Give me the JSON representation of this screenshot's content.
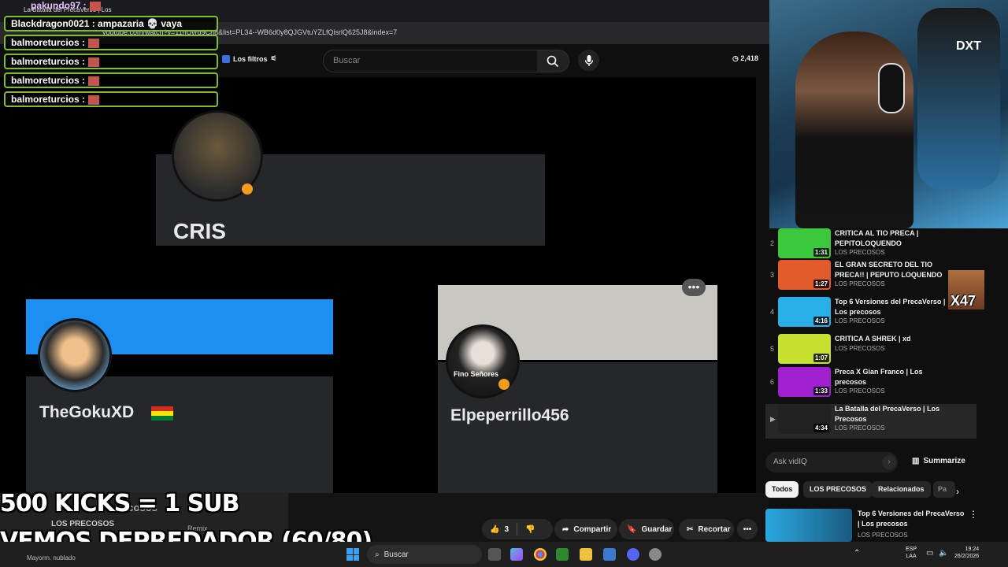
{
  "browser": {
    "address": "youtube.com/watch?v=11hUvrq9Ch8&list=PL34--WB6d0y8QJGVtuYZLfQisrlQ625J8&index=7",
    "tab_title": "La Batalla del PrecaVerso | Los"
  },
  "yt_header": {
    "filters_label": "Los filtros",
    "search_placeholder": "Buscar",
    "counter": "2,418"
  },
  "video": {
    "cards": [
      {
        "name": "CRIS"
      },
      {
        "name": "TheGokuXD"
      },
      {
        "name": "Elpeperrillo456",
        "avatar_text": "Fino Señores"
      }
    ],
    "partial_title": "recosos",
    "channel": "LOS PRECOSOS",
    "remix": "Remix"
  },
  "actions": {
    "likes": "3",
    "share": "Compartir",
    "save": "Guardar",
    "clip": "Recortar"
  },
  "chat": {
    "top_user": "pakundo97 :",
    "messages": [
      {
        "text": "Blackdragon0021 : ampazaria 💀 vaya"
      },
      {
        "text": "balmoreturcios :"
      },
      {
        "text": "balmoreturcios :"
      },
      {
        "text": "balmoreturcios :"
      },
      {
        "text": "balmoreturcios :"
      }
    ]
  },
  "promo": {
    "line1": "500 KICKS = 1 SUB",
    "line2": "VEMOS DEPREDADOR (60/80)"
  },
  "webcam": {
    "chair_logo": "DXT"
  },
  "playlist": [
    {
      "idx": "2",
      "title": "CRITICA AL TIO PRECA | PEPITOLOQUENDO",
      "channel": "LOS PRECOSOS",
      "duration": "1:31",
      "color": "#3cc83c"
    },
    {
      "idx": "3",
      "title": "EL GRAN SECRETO DEL TIO PRECA!! | PEPUTO LOQUENDO",
      "channel": "LOS PRECOSOS",
      "duration": "1:27",
      "color": "#e05a2a"
    },
    {
      "idx": "4",
      "title": "Top 6 Versiones del PrecaVerso | Los precosos",
      "channel": "LOS PRECOSOS",
      "duration": "4:16",
      "color": "#2ab0e8"
    },
    {
      "idx": "5",
      "title": "CRITICA A SHREK | xd",
      "channel": "LOS PRECOSOS",
      "duration": "1:07",
      "color": "#c8e030"
    },
    {
      "idx": "6",
      "title": "Preca X Gian Franco | Los precosos",
      "channel": "LOS PRECOSOS",
      "duration": "1:33",
      "color": "#a020d0"
    },
    {
      "idx": "▶",
      "title": "La Batalla del PrecaVerso | Los Precosos",
      "channel": "LOS PRECOSOS",
      "duration": "4:34",
      "color": "#222222"
    }
  ],
  "x47": "X47",
  "vidiq": {
    "placeholder": "Ask vidIQ",
    "summarize": "Summarize"
  },
  "chips": [
    "Todos",
    "LOS PRECOSOS",
    "Relacionados",
    "Pa"
  ],
  "recommendation": {
    "title": "Top 6 Versiones del PrecaVerso | Los precosos",
    "channel": "LOS PRECOSOS"
  },
  "taskbar": {
    "search": "Buscar",
    "lang_top": "ESP",
    "lang_bottom": "LAA",
    "time": "19:24",
    "date": "26/2/2026",
    "weather": "Mayorm. nublado"
  }
}
